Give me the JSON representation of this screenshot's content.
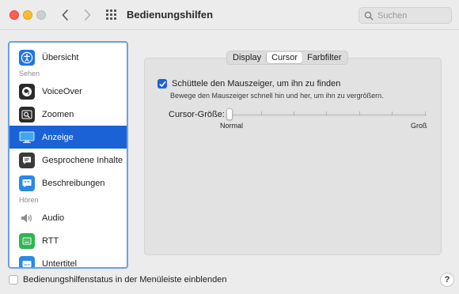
{
  "window": {
    "title": "Bedienungshilfen"
  },
  "search": {
    "placeholder": "Suchen"
  },
  "sidebar": {
    "items": [
      {
        "label": "Übersicht",
        "icon": "accessibility-icon",
        "color": "#1f74e8"
      },
      {
        "label": "VoiceOver",
        "icon": "voiceover-icon",
        "color": "#2b2b2b"
      },
      {
        "label": "Zoomen",
        "icon": "zoom-icon",
        "color": "#2b2b2b"
      },
      {
        "label": "Anzeige",
        "icon": "display-icon",
        "color": "#3ea7f2",
        "selected": true
      },
      {
        "label": "Gesprochene Inhalte",
        "icon": "spoken-content-icon",
        "color": "#3a3a3a"
      },
      {
        "label": "Beschreibungen",
        "icon": "descriptions-icon",
        "color": "#2a88e6"
      },
      {
        "label": "Audio",
        "icon": "audio-icon",
        "color": "#8c8c8c"
      },
      {
        "label": "RTT",
        "icon": "rtt-icon",
        "color": "#2fb551"
      },
      {
        "label": "Untertitel",
        "icon": "captions-icon",
        "color": "#2a88e6"
      }
    ],
    "sections": [
      "Sehen",
      "Hören"
    ]
  },
  "tabs": [
    {
      "label": "Display",
      "active": false
    },
    {
      "label": "Cursor",
      "active": true
    },
    {
      "label": "Farbfilter",
      "active": false
    }
  ],
  "cursor": {
    "shake_label": "Schüttele den Mauszeiger, um ihn zu finden",
    "shake_checked": true,
    "shake_description": "Bewege den Mauszeiger schnell hin und her, um ihn zu vergrößern.",
    "size_label": "Cursor-Größe:",
    "size_min": "Normal",
    "size_max": "Groß",
    "size_value": 0
  },
  "footer": {
    "menubar_label": "Bedienungshilfenstatus in der Menüleiste einblenden",
    "menubar_checked": false,
    "help_label": "?"
  },
  "colors": {
    "accent": "#1a62d6",
    "focus_ring": "#6d9ee6"
  }
}
